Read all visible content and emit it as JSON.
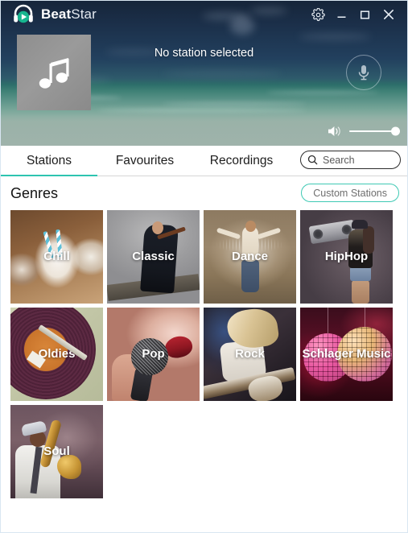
{
  "window": {
    "brand_bold": "Beat",
    "brand_light": "Star",
    "logo_icon": "headphones-play-icon",
    "controls": {
      "settings_label": "Settings",
      "settings_icon": "gear-icon",
      "minimize_label": "Minimize",
      "minimize_icon": "minimize-icon",
      "maximize_label": "Maximize",
      "maximize_icon": "maximize-icon",
      "close_label": "Close",
      "close_icon": "close-icon"
    }
  },
  "player": {
    "now_playing": "No station selected",
    "album_art_icon": "music-note-icon",
    "mic_icon": "microphone-icon",
    "volume_icon": "speaker-volume-icon",
    "volume_percent": 100
  },
  "tabs": [
    {
      "label": "Stations",
      "active": true
    },
    {
      "label": "Favourites",
      "active": false
    },
    {
      "label": "Recordings",
      "active": false
    }
  ],
  "search": {
    "placeholder": "Search",
    "value": "",
    "icon": "search-icon"
  },
  "content": {
    "section_title": "Genres",
    "custom_stations_label": "Custom Stations"
  },
  "genres": [
    {
      "label": "Chill"
    },
    {
      "label": "Classic"
    },
    {
      "label": "Dance"
    },
    {
      "label": "HipHop"
    },
    {
      "label": "Oldies"
    },
    {
      "label": "Pop"
    },
    {
      "label": "Rock"
    },
    {
      "label": "Schlager Music"
    },
    {
      "label": "Soul"
    }
  ],
  "colors": {
    "accent_teal": "#2ec4b0",
    "custom_btn_border": "#3fc9b4",
    "titlebar_dark": "#16253a",
    "window_border": "#d9e6f2"
  }
}
